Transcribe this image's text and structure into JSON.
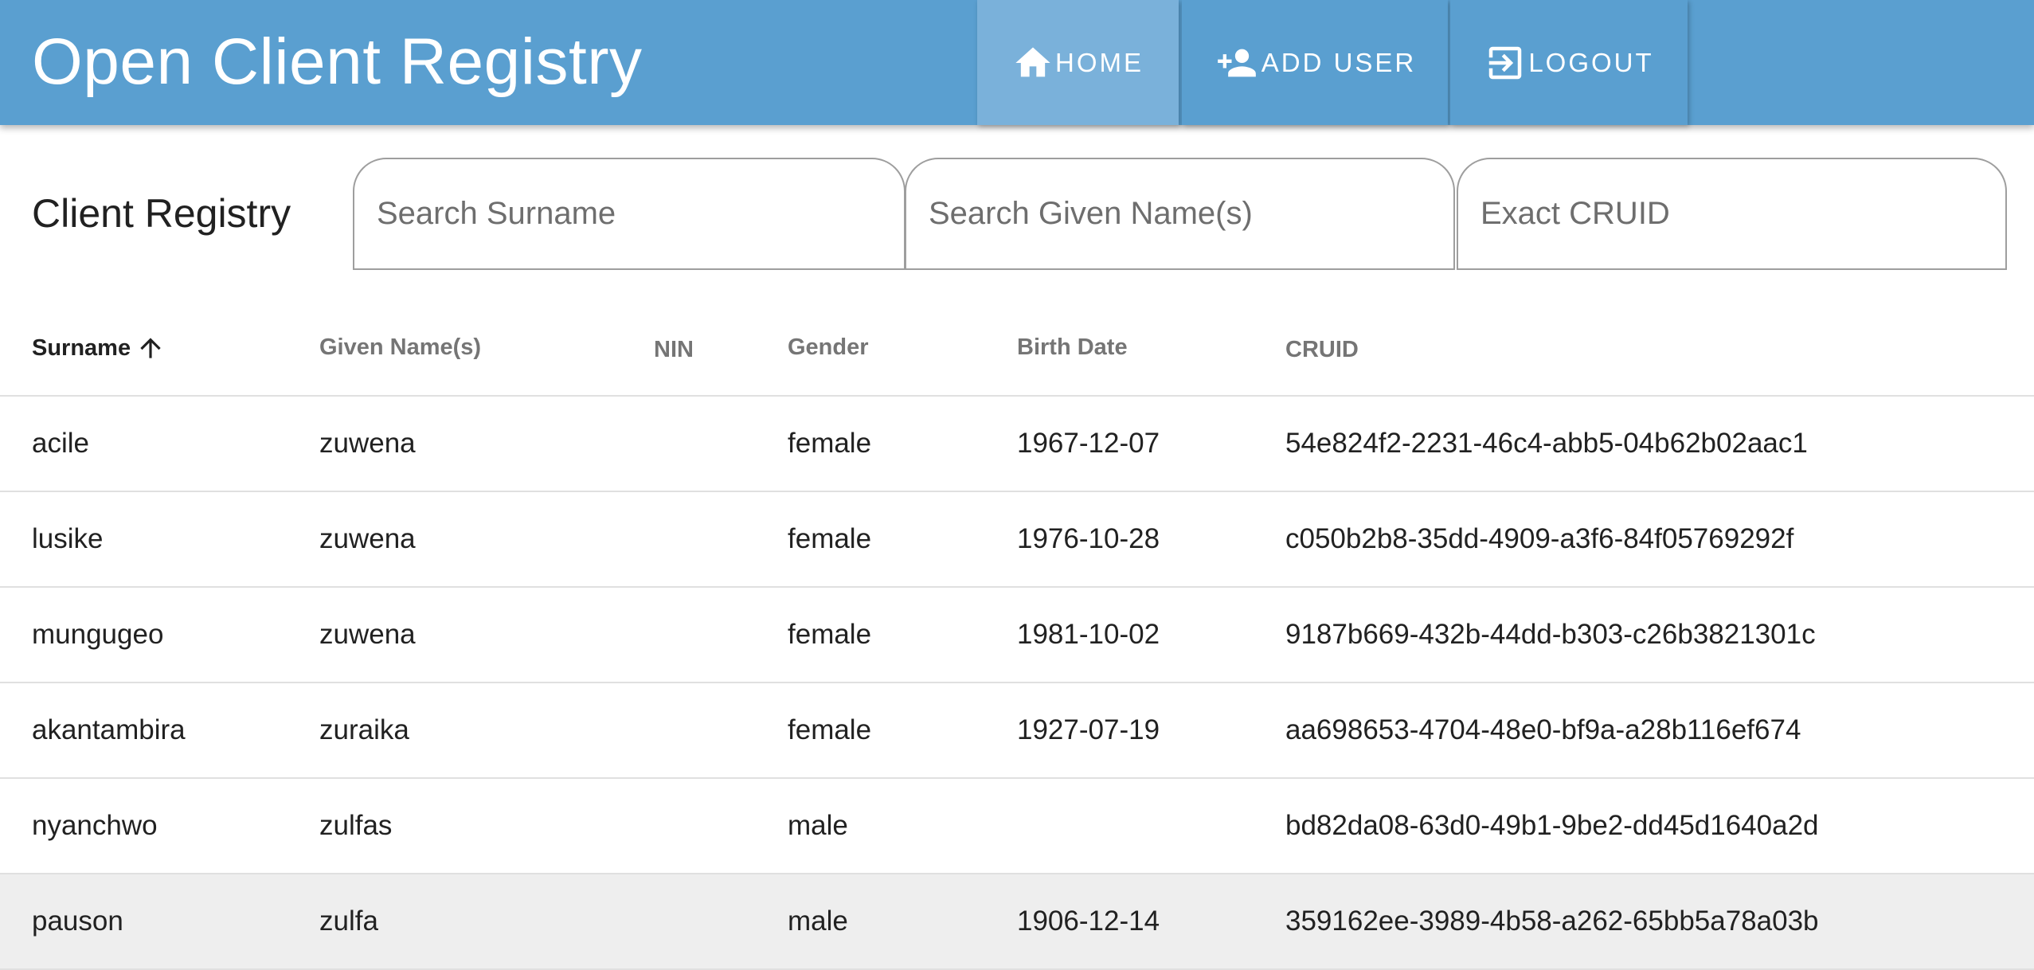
{
  "app": {
    "title": "Open Client Registry"
  },
  "nav": {
    "home_label": "HOME",
    "add_user_label": "ADD USER",
    "logout_label": "LOGOUT"
  },
  "toolbar": {
    "title": "Client Registry"
  },
  "search": {
    "surname_placeholder": "Search Surname",
    "given_placeholder": "Search Given Name(s)",
    "cruid_placeholder": "Exact CRUID"
  },
  "table": {
    "headers": {
      "surname": "Surname",
      "given": "Given Name(s)",
      "nin": "NIN",
      "gender": "Gender",
      "birth_date": "Birth Date",
      "cruid": "CRUID"
    },
    "rows": [
      {
        "surname": "acile",
        "given": "zuwena",
        "nin": "",
        "gender": "female",
        "birth_date": "1967-12-07",
        "cruid": "54e824f2-2231-46c4-abb5-04b62b02aac1"
      },
      {
        "surname": "lusike",
        "given": "zuwena",
        "nin": "",
        "gender": "female",
        "birth_date": "1976-10-28",
        "cruid": "c050b2b8-35dd-4909-a3f6-84f05769292f"
      },
      {
        "surname": "mungugeo",
        "given": "zuwena",
        "nin": "",
        "gender": "female",
        "birth_date": "1981-10-02",
        "cruid": "9187b669-432b-44dd-b303-c26b3821301c"
      },
      {
        "surname": "akantambira",
        "given": "zuraika",
        "nin": "",
        "gender": "female",
        "birth_date": "1927-07-19",
        "cruid": "aa698653-4704-48e0-bf9a-a28b116ef674"
      },
      {
        "surname": "nyanchwo",
        "given": "zulfas",
        "nin": "",
        "gender": "male",
        "birth_date": "",
        "cruid": "bd82da08-63d0-49b1-9be2-dd45d1640a2d"
      },
      {
        "surname": "pauson",
        "given": "zulfa",
        "nin": "",
        "gender": "male",
        "birth_date": "1906-12-14",
        "cruid": "359162ee-3989-4b58-a262-65bb5a78a03b"
      }
    ]
  },
  "colors": {
    "appbar": "#5a9fd0",
    "nav_active": "#7ab1da",
    "row_hover": "#eeeeee"
  }
}
